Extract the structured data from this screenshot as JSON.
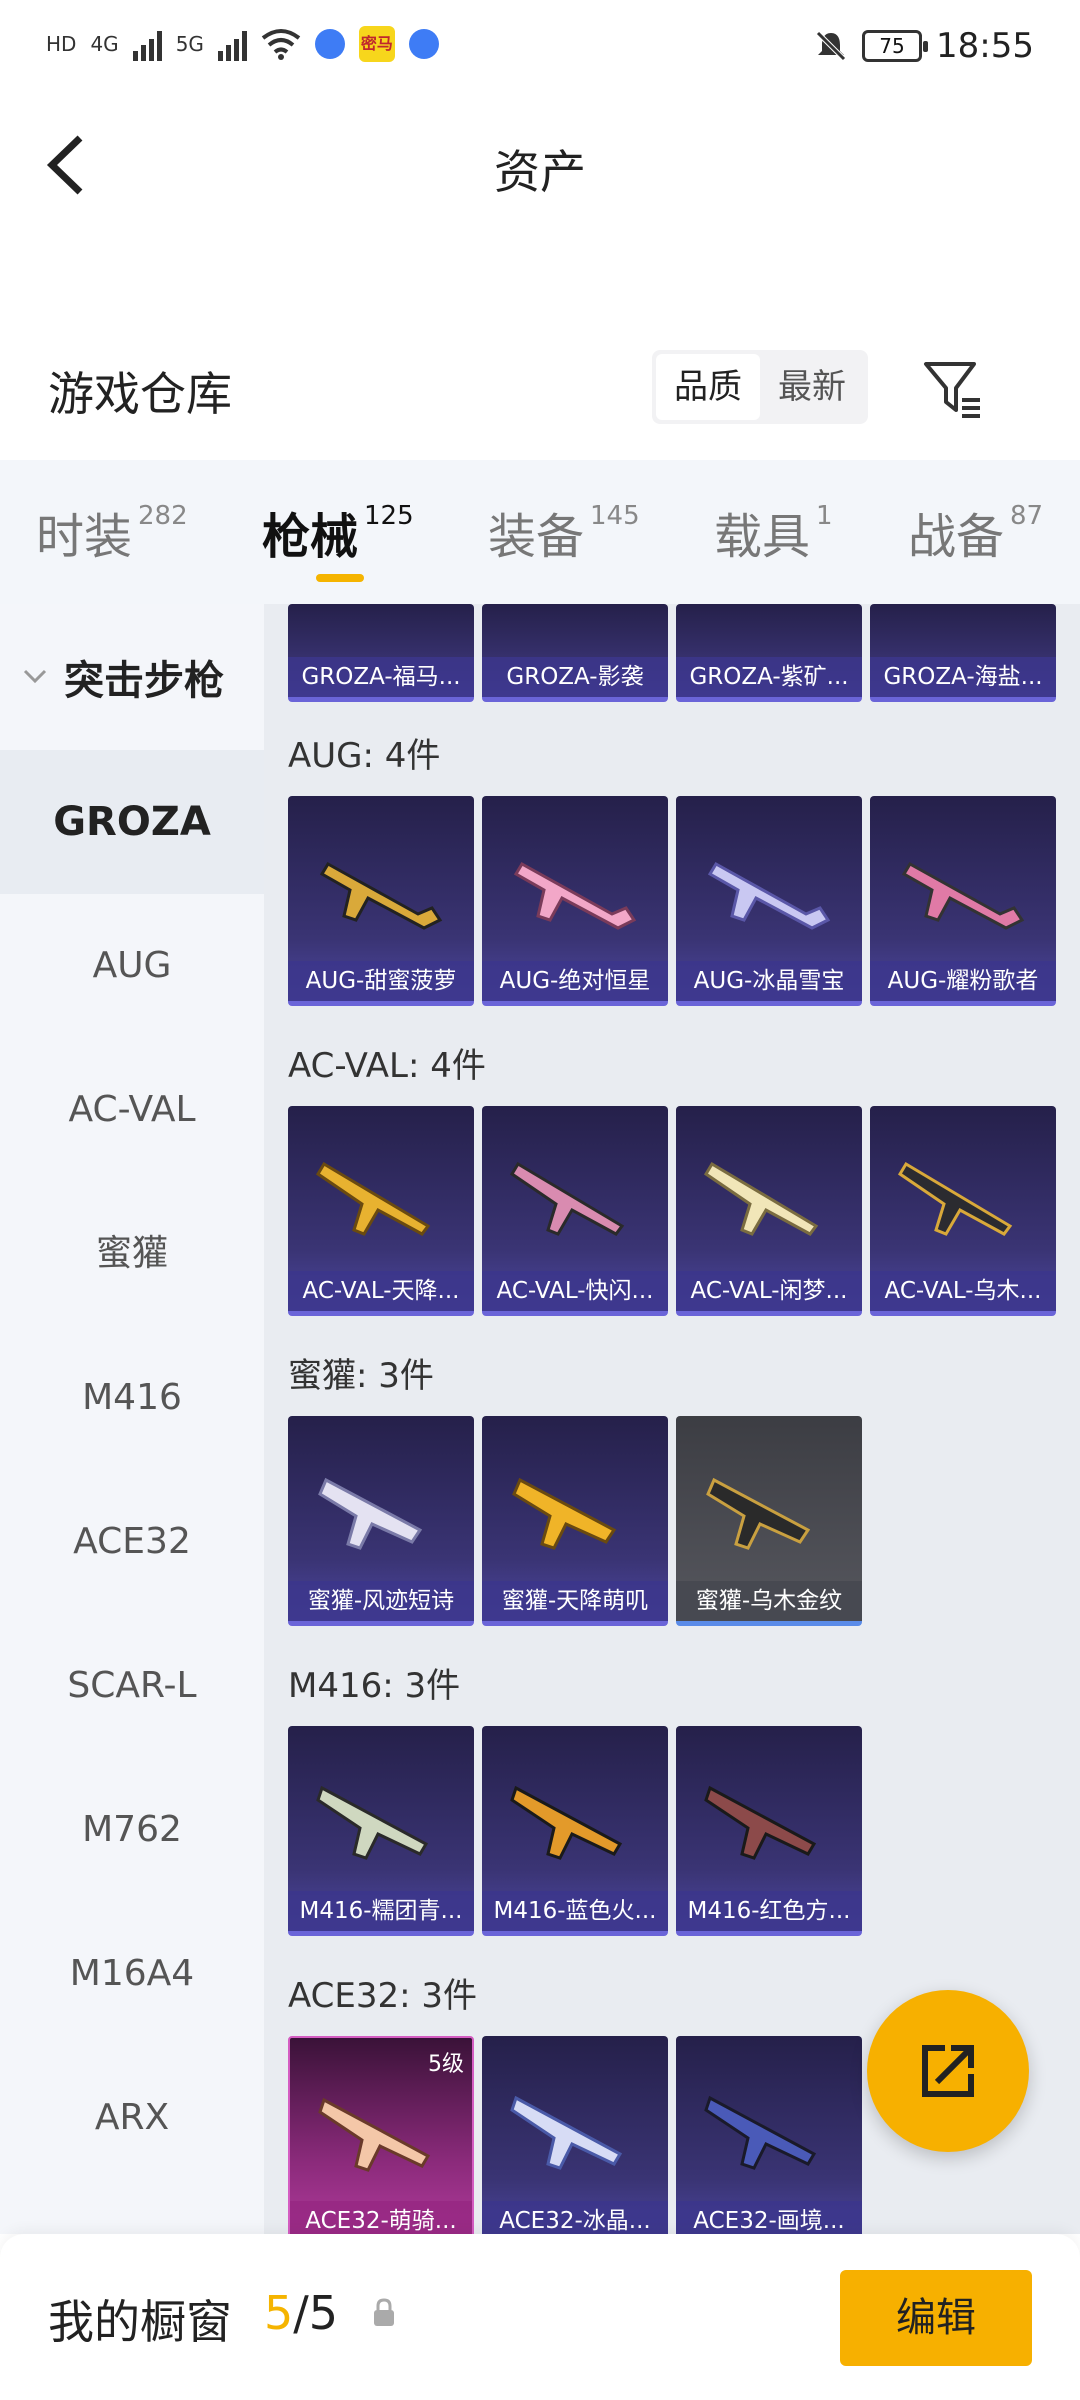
{
  "status_bar": {
    "network_hd": "HD",
    "sig1_label": "4G",
    "sig2_label": "5G",
    "app_badge": "密马",
    "battery": "75",
    "time": "18:55"
  },
  "header": {
    "title": "资产"
  },
  "warehouse": {
    "title": "游戏仓库",
    "sort_options": [
      "品质",
      "最新"
    ],
    "sort_active": "品质"
  },
  "tabs": [
    {
      "label": "时装",
      "count": "282"
    },
    {
      "label": "枪械",
      "count": "125"
    },
    {
      "label": "装备",
      "count": "145"
    },
    {
      "label": "载具",
      "count": "1"
    },
    {
      "label": "战备",
      "count": "87"
    }
  ],
  "sidebar": {
    "group": "突击步枪",
    "items": [
      "GROZA",
      "AUG",
      "AC-VAL",
      "蜜獾",
      "M416",
      "ACE32",
      "SCAR-L",
      "M762",
      "M16A4",
      "ARX"
    ]
  },
  "grid": {
    "top_partial": [
      "GROZA-福马...",
      "GROZA-影袭",
      "GROZA-紫矿...",
      "GROZA-海盐..."
    ],
    "sections": [
      {
        "title": "AUG: 4件",
        "items": [
          "AUG-甜蜜菠萝",
          "AUG-绝对恒星",
          "AUG-冰晶雪宝",
          "AUG-耀粉歌者"
        ]
      },
      {
        "title": "AC-VAL: 4件",
        "items": [
          "AC-VAL-天降...",
          "AC-VAL-快闪...",
          "AC-VAL-闲梦...",
          "AC-VAL-乌木..."
        ]
      },
      {
        "title": "蜜獾: 3件",
        "items": [
          "蜜獾-风迹短诗",
          "蜜獾-天降萌叽",
          "蜜獾-乌木金纹"
        ]
      },
      {
        "title": "M416: 3件",
        "items": [
          "M416-糯团青...",
          "M416-蓝色火...",
          "M416-红色方..."
        ]
      },
      {
        "title": "ACE32: 3件",
        "items": [
          "ACE32-萌骑...",
          "ACE32-冰晶...",
          "ACE32-画境..."
        ],
        "level_badge": "5级"
      }
    ]
  },
  "bottom": {
    "showcase_label": "我的橱窗",
    "showcase_current": "5",
    "showcase_sep": "/",
    "showcase_max": "5",
    "edit_label": "编辑"
  },
  "colors": {
    "accent": "#f7b000",
    "card_bg": "#3a3474",
    "page_bg": "#e9ecf1"
  }
}
